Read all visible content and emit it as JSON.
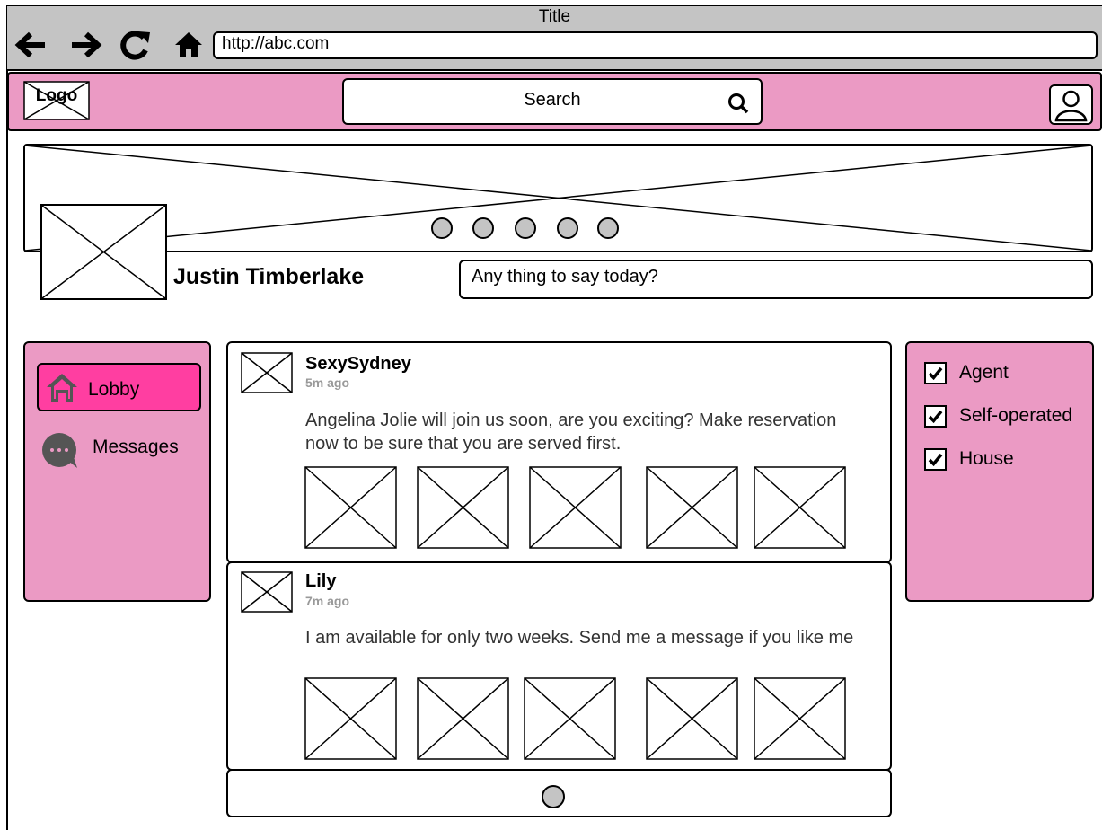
{
  "window": {
    "title": "Title",
    "url": "http://abc.com"
  },
  "header": {
    "logo_text": "Logo",
    "search_placeholder": "Search"
  },
  "profile": {
    "name": "Justin Timberlake",
    "status_placeholder": "Any thing to say today?",
    "cover_slides": 5
  },
  "nav": {
    "items": [
      {
        "label": "Lobby",
        "icon": "home-icon",
        "active": true
      },
      {
        "label": "Messages",
        "icon": "chat-bubble-icon",
        "active": false
      }
    ]
  },
  "feed": {
    "posts": [
      {
        "author": "SexySydney",
        "time": "5m ago",
        "body": "Angelina Jolie will join us soon, are you exciting? Make reservation now to be sure that you are served first.",
        "image_count": 5
      },
      {
        "author": "Lily",
        "time": "7m ago",
        "body": "I am available for only two weeks. Send me a message if you like me",
        "image_count": 5
      }
    ]
  },
  "filters": [
    {
      "label": "Agent",
      "checked": true
    },
    {
      "label": "Self-operated",
      "checked": true
    },
    {
      "label": "House",
      "checked": true
    }
  ],
  "colors": {
    "header_bg": "#eb9ac4",
    "active_nav": "#ff3ea1",
    "titlebar_bg": "#c4c4c4"
  }
}
